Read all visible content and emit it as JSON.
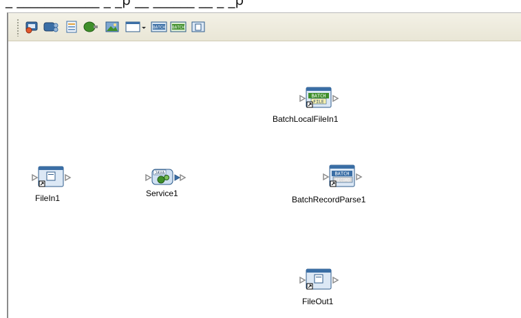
{
  "window": {
    "partial_title": "_ ____________ _ _p __ ______ __ _ _p"
  },
  "toolbar": {
    "buttons": [
      {
        "name": "add-external-icon",
        "tooltip": ""
      },
      {
        "name": "add-service-icon",
        "tooltip": ""
      },
      {
        "name": "add-document-icon",
        "tooltip": ""
      },
      {
        "name": "add-connector-icon",
        "tooltip": ""
      },
      {
        "name": "add-image-icon",
        "tooltip": ""
      },
      {
        "name": "window-dropdown-icon",
        "tooltip": ""
      },
      {
        "name": "batch-icon",
        "label": "BATCH"
      },
      {
        "name": "batch-green-icon",
        "label": "BATCH"
      },
      {
        "name": "file-icon",
        "tooltip": ""
      }
    ]
  },
  "components": [
    {
      "id": "BatchLocalFileIn1",
      "label": "BatchLocalFileIn1",
      "type": "batch-file",
      "badge_top": "BATCH",
      "badge_bottom": "FILE"
    },
    {
      "id": "FileIn1",
      "label": "FileIn1",
      "type": "file"
    },
    {
      "id": "Service1",
      "label": "Service1",
      "type": "java-service",
      "badge_top": "JAVA"
    },
    {
      "id": "BatchRecordParse1",
      "label": "BatchRecordParse1",
      "type": "batch-record",
      "badge_top": "BATCH",
      "badge_bottom": "RECORD"
    },
    {
      "id": "FileOut1",
      "label": "FileOut1",
      "type": "file"
    }
  ],
  "colors": {
    "toolbar_bg": "#ece9d8",
    "icon_blue": "#3a6ea5",
    "icon_green": "#3f8f2a",
    "arrow_gray": "#8c8c8c"
  }
}
